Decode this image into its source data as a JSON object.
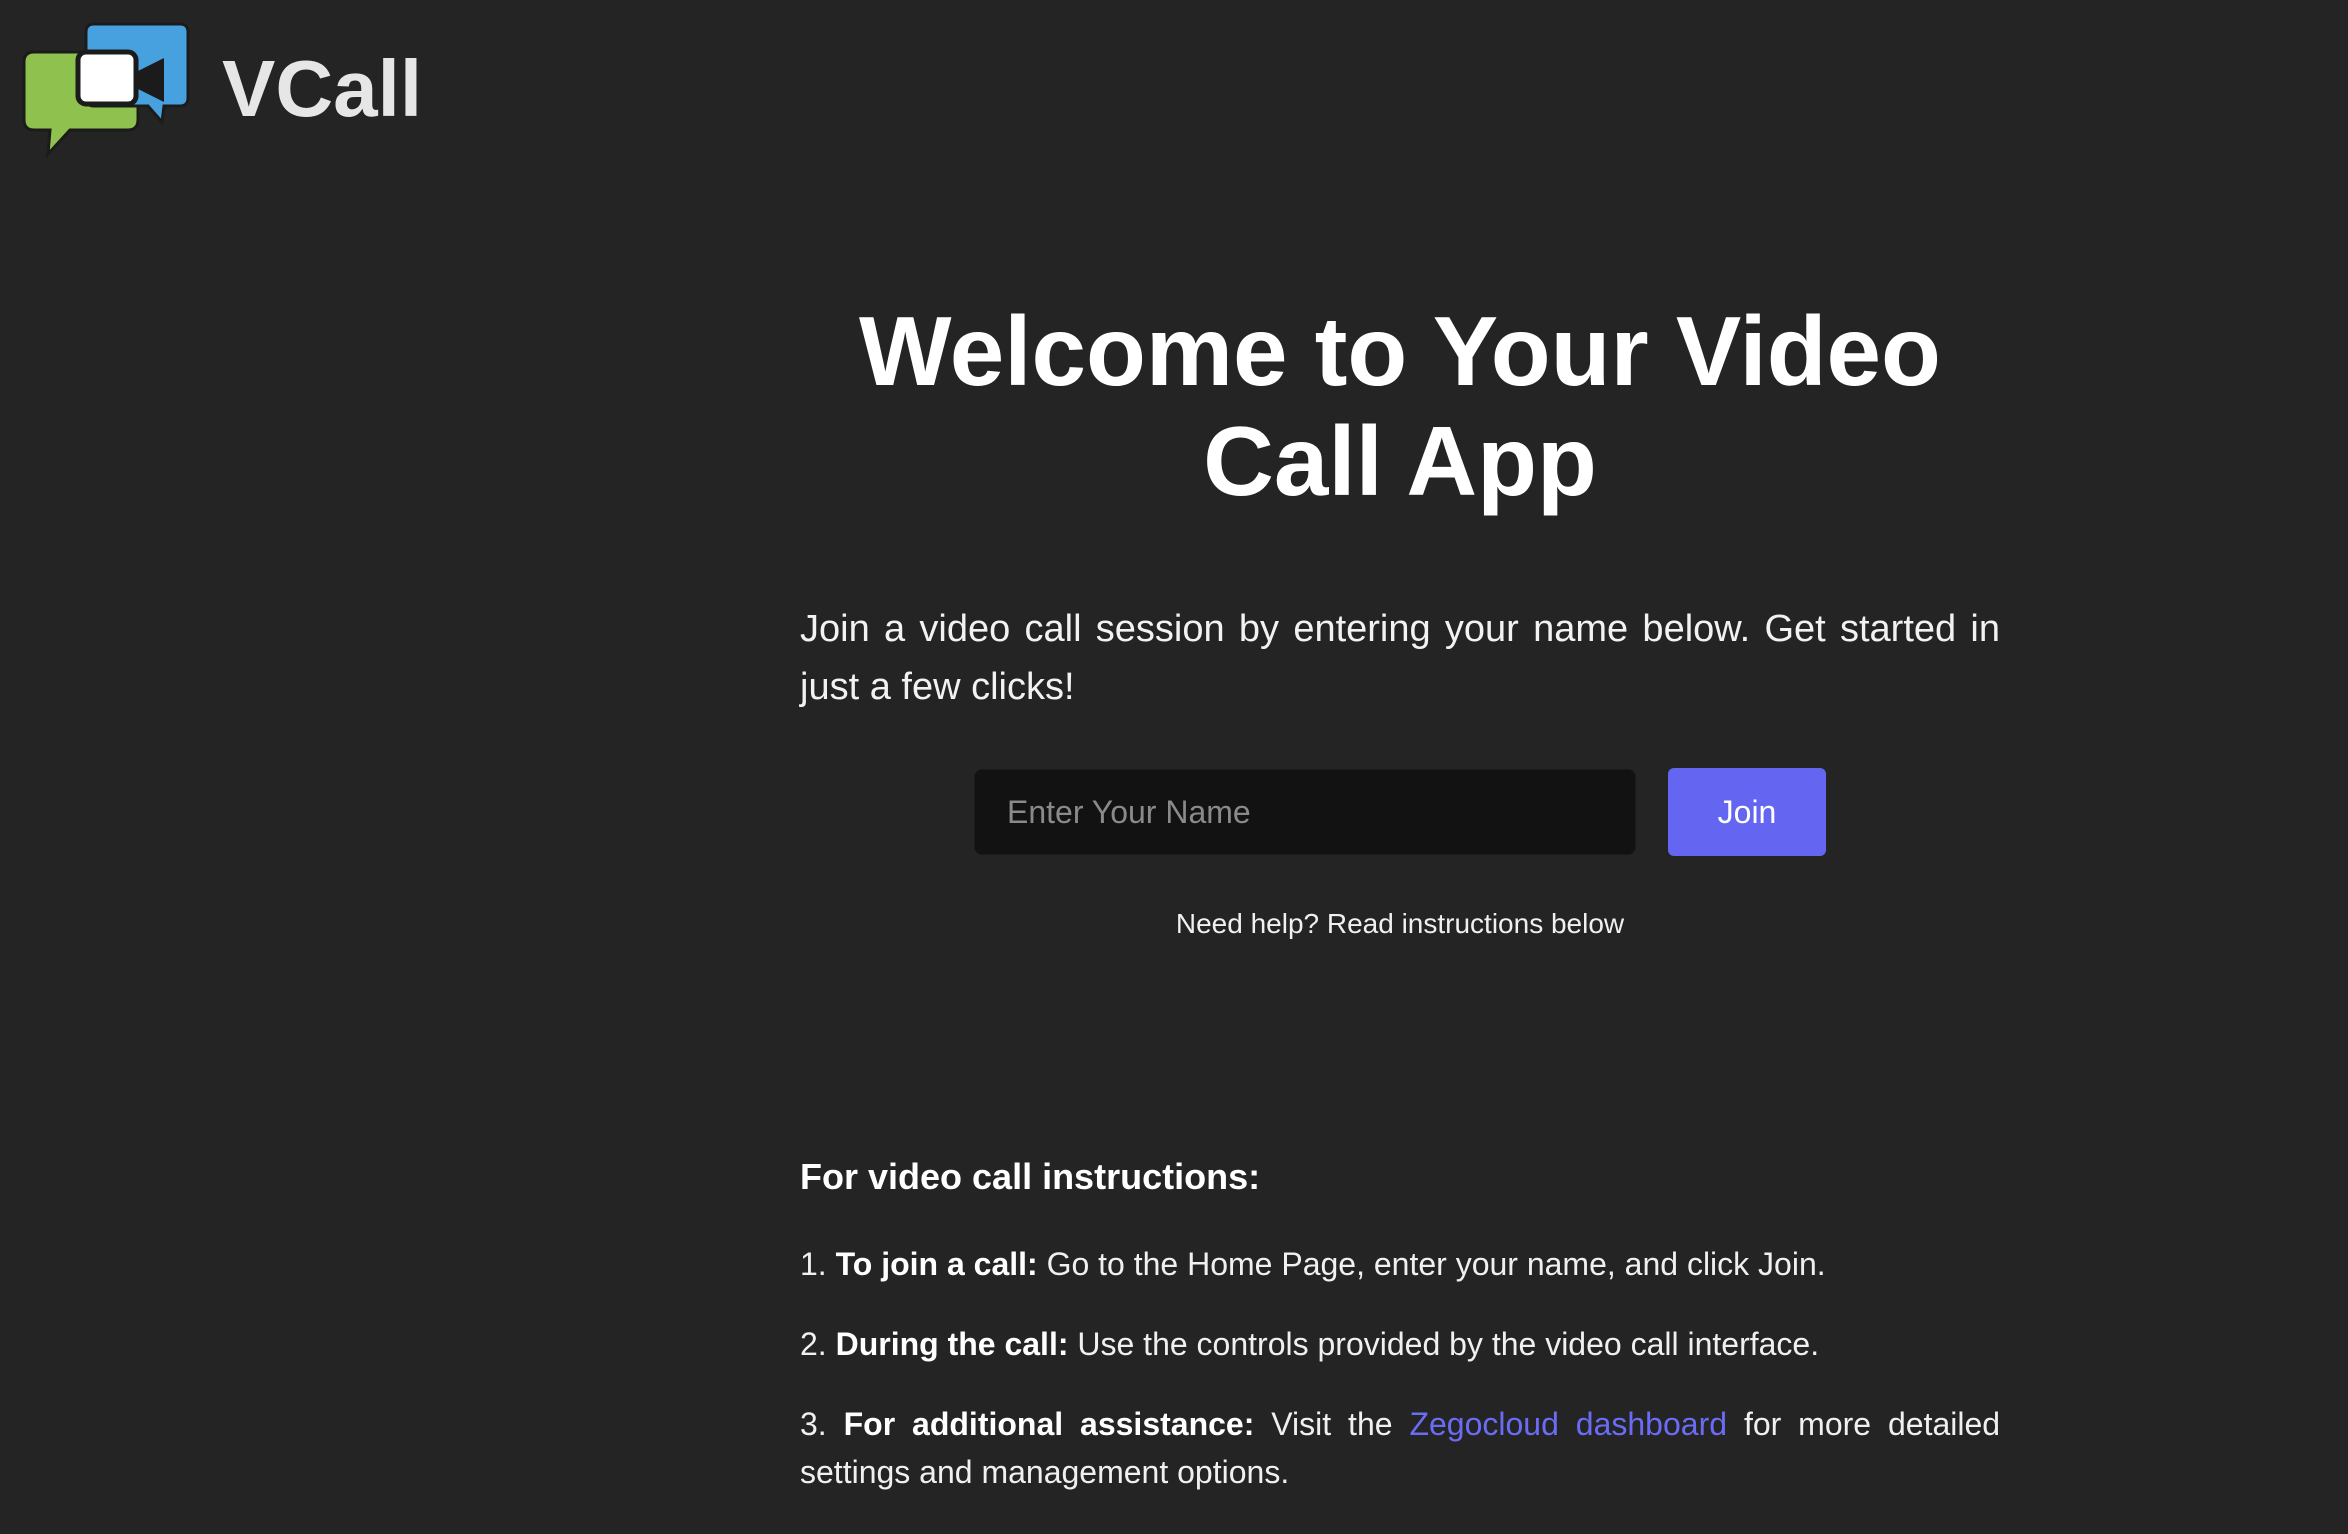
{
  "brand": {
    "name": "VCall",
    "logo_icon": "video-chat-bubbles-icon"
  },
  "hero": {
    "title_line1": "Welcome to Your Video",
    "title_line2": "Call App",
    "intro": "Join a video call session by entering your name below. Get started in just a few clicks!",
    "input_placeholder": "Enter Your Name",
    "input_value": "",
    "join_label": "Join",
    "help_text": "Need help? Read instructions below"
  },
  "instructions": {
    "heading": "For video call instructions:",
    "steps": [
      {
        "number": "1.",
        "label": "To join a call:",
        "text": "Go to the Home Page, enter your name, and click Join."
      },
      {
        "number": "2.",
        "label": "During the call:",
        "text": "Use the controls provided by the video call interface."
      },
      {
        "number": "3.",
        "label": "For additional assistance:",
        "text_before": "Visit the",
        "link_text": "Zegocloud dashboard",
        "text_after": "for more detailed settings and management options."
      }
    ]
  },
  "colors": {
    "background": "#242424",
    "accent": "#6466f1",
    "link": "#6a6cf5",
    "input_bg": "#121212"
  }
}
